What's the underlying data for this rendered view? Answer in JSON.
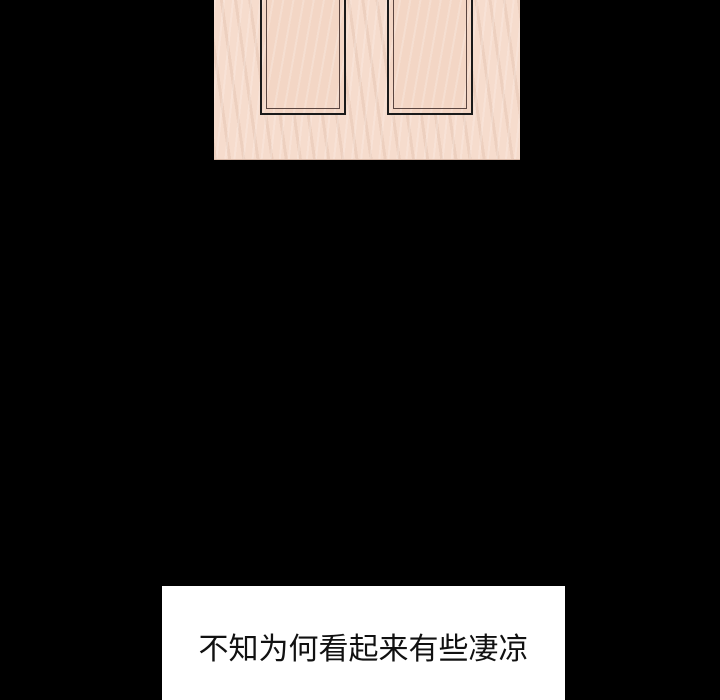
{
  "caption": {
    "text": "不知为何看起来有些凄凉"
  },
  "colors": {
    "background": "#000000",
    "door_wood": "#f6dccd",
    "caption_bg": "#ffffff",
    "caption_text": "#111111"
  }
}
